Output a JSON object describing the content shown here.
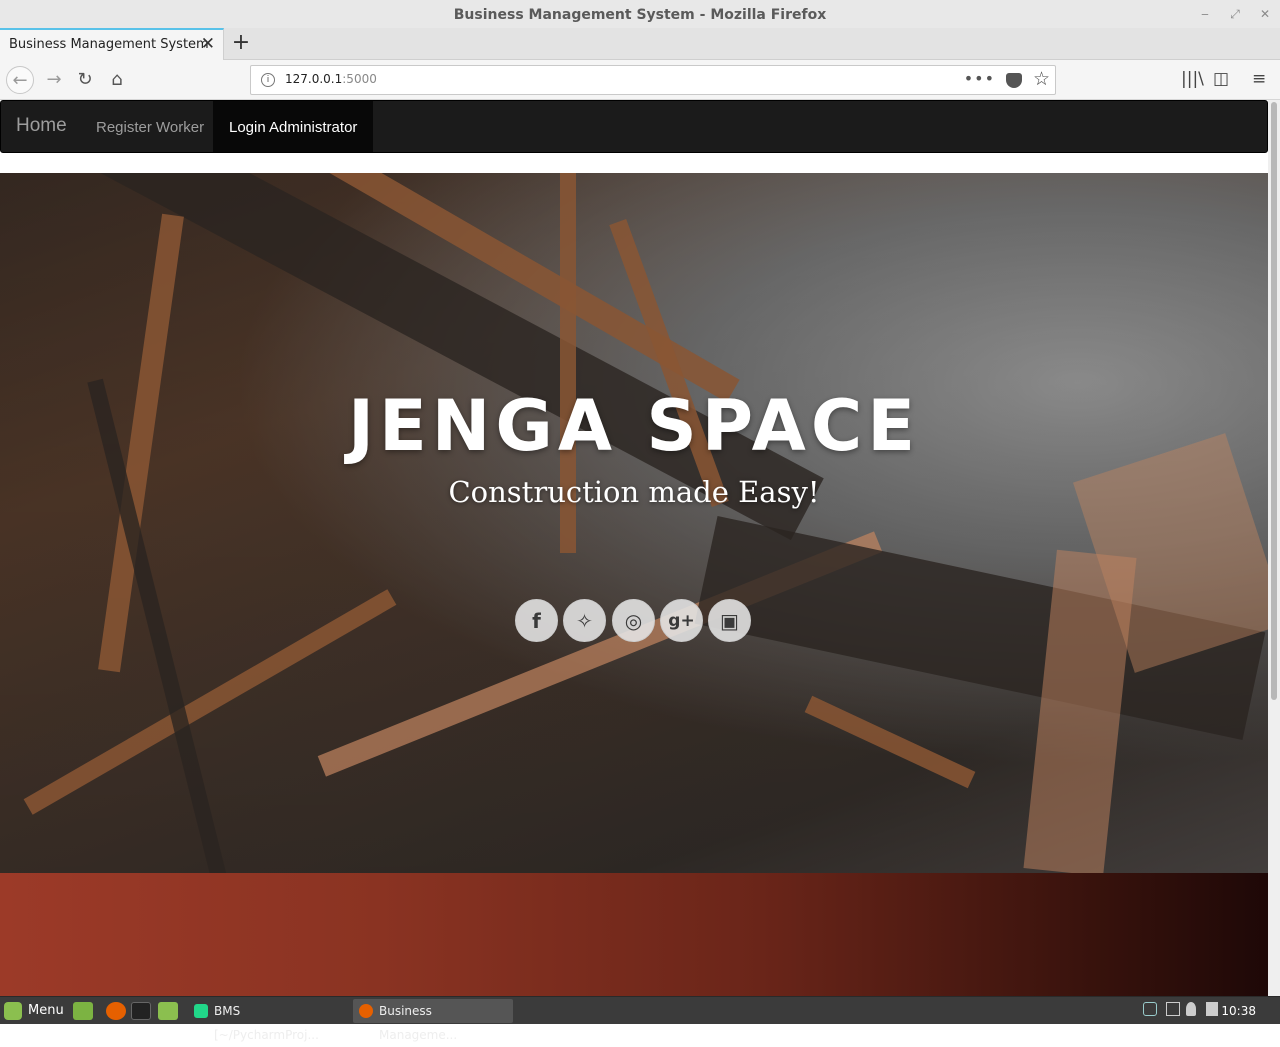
{
  "window": {
    "title": "Business Management System - Mozilla Firefox",
    "minimize": "‒",
    "restore": "⤢",
    "close": "✕"
  },
  "browser": {
    "tab_title": "Business Management System",
    "tab_close": "✕",
    "new_tab": "+",
    "url_host": "127.0.0.1",
    "url_port": ":5000",
    "page_actions": "•••",
    "back": "←",
    "forward": "→",
    "reload": "↻",
    "home": "⌂",
    "bookmark": "☆",
    "library": "|||\\",
    "sidebar": "◫",
    "menu": "≡",
    "info": "i"
  },
  "site": {
    "nav": {
      "brand": "Home",
      "links": [
        "Register Worker",
        "Login Administrator"
      ]
    },
    "hero": {
      "heading": "JENGA SPACE",
      "subheading": "Construction made Easy!",
      "social": [
        {
          "icon": "facebook-icon",
          "glyph": "f"
        },
        {
          "icon": "twitter-icon",
          "glyph": "✧"
        },
        {
          "icon": "dribbble-icon",
          "glyph": "◎"
        },
        {
          "icon": "google-plus-icon",
          "glyph": "g+"
        },
        {
          "icon": "instagram-icon",
          "glyph": "▣"
        }
      ]
    }
  },
  "taskbar": {
    "menu_label": "Menu",
    "tasks": [
      {
        "label": "BMS [~/PycharmProj...",
        "icon": "pycharm-icon",
        "active": false
      },
      {
        "label": "Business Manageme...",
        "icon": "firefox-icon",
        "active": true
      }
    ],
    "clock": "10:38"
  },
  "colors": {
    "accent_tab": "#58c2e9",
    "navbar_bg": "#1b1b1b",
    "band_start": "#9c3a28",
    "band_end": "#1e0807"
  }
}
